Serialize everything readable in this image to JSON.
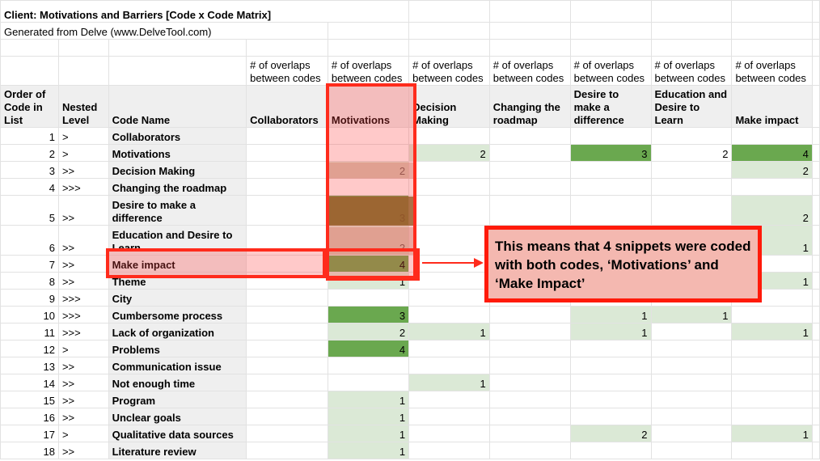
{
  "title": "Client: Motivations and Barriers [Code x Code Matrix]",
  "subtitle": "Generated from Delve (www.DelveTool.com)",
  "overlap_label": "# of overlaps between codes",
  "headers": {
    "order": "Order of Code in List",
    "nested": "Nested Level",
    "code_name": "Code Name",
    "columns": [
      "Collaborators",
      "Motivations",
      "Decision Making",
      "Changing the roadmap",
      "Desire to make a difference",
      "Education and Desire to Learn",
      "Make impact"
    ]
  },
  "rows": [
    {
      "order": "1",
      "level": ">",
      "name": "Collaborators",
      "cells": [
        "",
        "",
        "",
        "",
        "",
        "",
        ""
      ]
    },
    {
      "order": "2",
      "level": ">",
      "name": "Motivations",
      "cells": [
        "",
        "",
        "2",
        "",
        "3",
        "2",
        "4"
      ]
    },
    {
      "order": "3",
      "level": ">>",
      "name": "Decision Making",
      "cells": [
        "",
        "2",
        "",
        "",
        "",
        "",
        "2"
      ]
    },
    {
      "order": "4",
      "level": ">>>",
      "name": "Changing the roadmap",
      "cells": [
        "",
        "",
        "",
        "",
        "",
        "",
        ""
      ]
    },
    {
      "order": "5",
      "level": ">>",
      "name": "Desire to make a difference",
      "cells": [
        "",
        "3",
        "",
        "",
        "",
        "",
        "2"
      ]
    },
    {
      "order": "6",
      "level": ">>",
      "name": "Education and Desire to Learn",
      "cells": [
        "",
        "2",
        "",
        "",
        "",
        "",
        "1"
      ]
    },
    {
      "order": "7",
      "level": ">>",
      "name": "Make impact",
      "cells": [
        "",
        "4",
        "",
        "",
        "",
        "",
        ""
      ]
    },
    {
      "order": "8",
      "level": ">>",
      "name": "Theme",
      "cells": [
        "",
        "1",
        "",
        "",
        "",
        "",
        "1"
      ]
    },
    {
      "order": "9",
      "level": ">>>",
      "name": "City",
      "cells": [
        "",
        "",
        "",
        "",
        "",
        "",
        ""
      ]
    },
    {
      "order": "10",
      "level": ">>>",
      "name": "Cumbersome process",
      "cells": [
        "",
        "3",
        "",
        "",
        "1",
        "1",
        ""
      ]
    },
    {
      "order": "11",
      "level": ">>>",
      "name": "Lack of organization",
      "cells": [
        "",
        "2",
        "1",
        "",
        "1",
        "",
        "1"
      ]
    },
    {
      "order": "12",
      "level": ">",
      "name": "Problems",
      "cells": [
        "",
        "4",
        "",
        "",
        "",
        "",
        ""
      ]
    },
    {
      "order": "13",
      "level": ">>",
      "name": "Communication issue",
      "cells": [
        "",
        "",
        "",
        "",
        "",
        "",
        ""
      ]
    },
    {
      "order": "14",
      "level": ">>",
      "name": "Not enough time",
      "cells": [
        "",
        "",
        "1",
        "",
        "",
        "",
        ""
      ]
    },
    {
      "order": "15",
      "level": ">>",
      "name": "Program",
      "cells": [
        "",
        "1",
        "",
        "",
        "",
        "",
        ""
      ]
    },
    {
      "order": "16",
      "level": ">>",
      "name": "Unclear goals",
      "cells": [
        "",
        "1",
        "",
        "",
        "",
        "",
        ""
      ]
    },
    {
      "order": "17",
      "level": ">",
      "name": "Qualitative data sources",
      "cells": [
        "",
        "1",
        "",
        "",
        "2",
        "",
        "1"
      ]
    },
    {
      "order": "18",
      "level": ">>",
      "name": "Literature review",
      "cells": [
        "",
        "1",
        "",
        "",
        "",
        "",
        ""
      ]
    }
  ],
  "callout": "This means that 4 snippets were coded with both codes, ‘Motivations’ and ‘Make Impact’",
  "colors": {
    "highlight_border": "#ff2b1c",
    "light_green": "#dbe9d6",
    "dark_green": "#6aa84f",
    "header_gray": "#efefef",
    "callout_fill": "#f4b8b0"
  }
}
